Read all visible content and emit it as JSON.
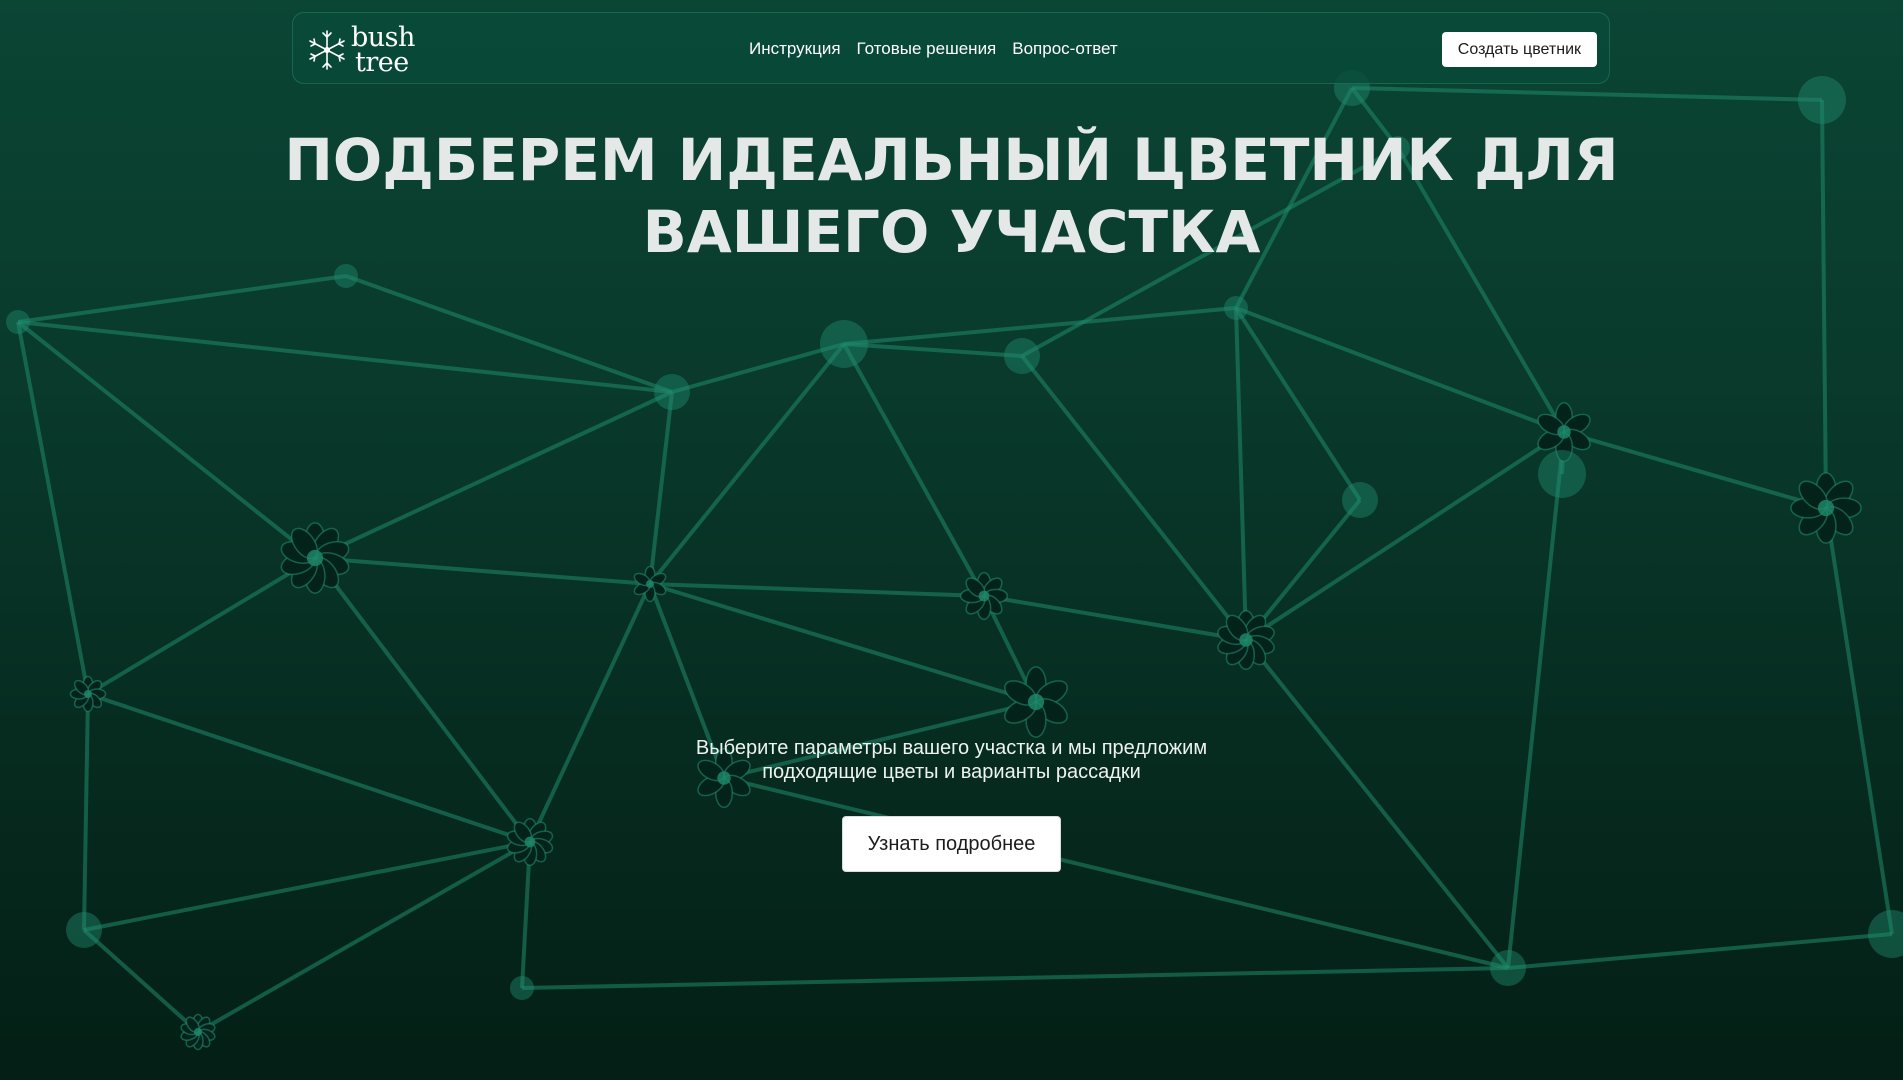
{
  "brand": {
    "line1": "bush",
    "line2": "tree",
    "logo_icon": "snowflake-branch-icon"
  },
  "nav": {
    "links": [
      {
        "label": "Инструкция"
      },
      {
        "label": "Готовые решения"
      },
      {
        "label": "Вопрос-ответ"
      }
    ],
    "cta_label": "Создать цветник"
  },
  "hero": {
    "title_line1": "ПОДБЕРЕМ ИДЕАЛЬНЫЙ ЦВЕТНИК ДЛЯ",
    "title_line2": "ВАШЕГО УЧАСТКА",
    "subtitle_line1": "Выберите параметры вашего участка и мы предложим",
    "subtitle_line2": "подходящие цветы и варианты рассадки",
    "button_label": "Узнать подробнее"
  },
  "background": {
    "style": "network-of-lines-with-flower-nodes",
    "flower_icon": "flower-icon",
    "colors": {
      "top": "#0b4534",
      "bottom": "#041f15",
      "line": "#1f8a6c",
      "flower": "#03231a"
    }
  }
}
